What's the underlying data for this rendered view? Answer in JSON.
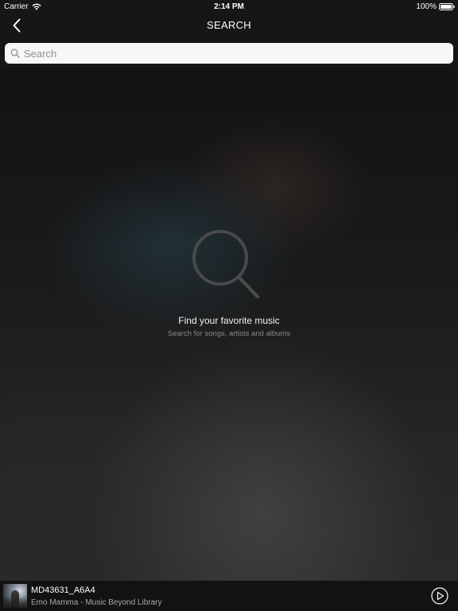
{
  "status_bar": {
    "carrier": "Carrier",
    "time": "2:14 PM",
    "battery": "100%",
    "wifi_icon": "wifi-icon",
    "battery_icon": "battery-icon"
  },
  "nav": {
    "title": "SEARCH",
    "back_icon": "chevron-left-icon"
  },
  "search": {
    "placeholder": "Search",
    "value": "",
    "icon": "search-icon"
  },
  "empty_state": {
    "icon": "magnifier-icon",
    "title": "Find your favorite music",
    "subtitle": "Search for songs, artists and albums"
  },
  "player": {
    "track_title": "MD43631_A6A4",
    "track_subtitle": "Emo Mamma - Music Beyond Library",
    "play_icon": "play-circle-icon"
  },
  "colors": {
    "background": "#161616",
    "search_bar": "#f7f7f7",
    "placeholder": "#8e8e93",
    "subtitle_text": "#8a8a8a",
    "player_bar": "#121212"
  }
}
